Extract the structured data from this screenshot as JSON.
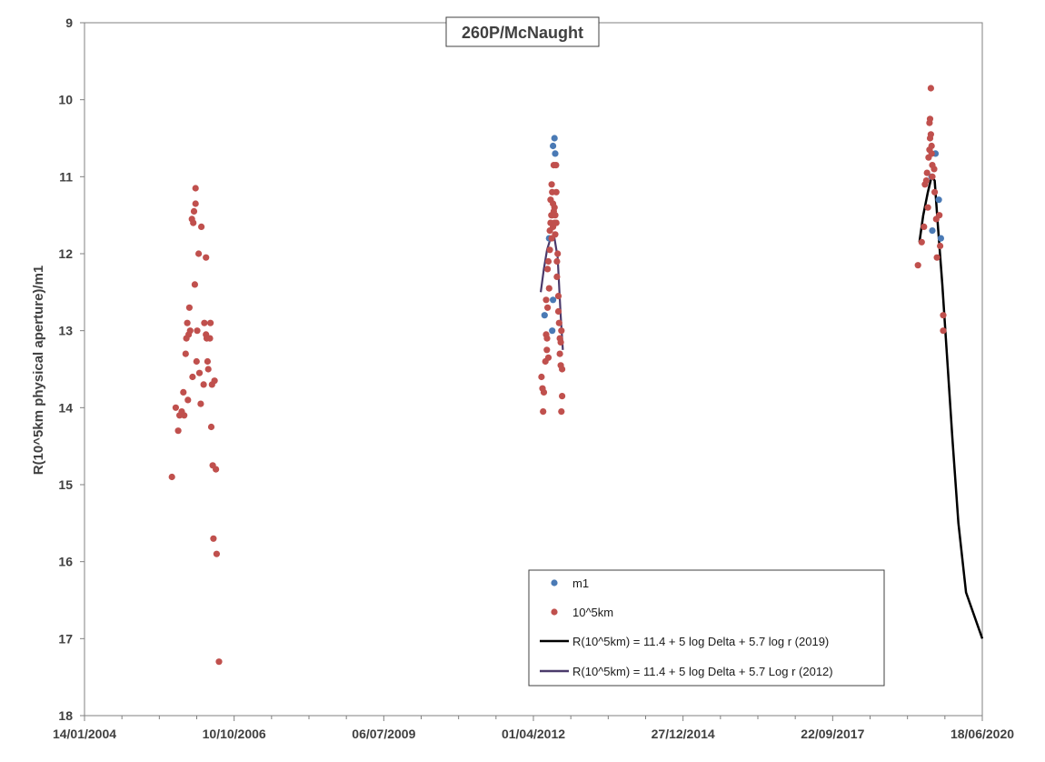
{
  "chart_data": {
    "type": "scatter",
    "title": "260P/McNaught",
    "ylabel": "R(10^5km physical aperture)/m1",
    "xlabel": "",
    "xlim": [
      "2004-01-14",
      "2020-06-18"
    ],
    "ylim": [
      9,
      18
    ],
    "y_inverted": true,
    "x_ticks": [
      "14/01/2004",
      "10/10/2006",
      "06/07/2009",
      "01/04/2012",
      "27/12/2014",
      "22/09/2017",
      "18/06/2020"
    ],
    "y_ticks": [
      "9",
      "10",
      "11",
      "12",
      "13",
      "14",
      "15",
      "16",
      "17",
      "18"
    ],
    "grid": false,
    "legend_position": "bottom-right",
    "colors": {
      "m1": "#4a7ab5",
      "r10": "#c0504d",
      "fit2019": "#000000",
      "fit2012": "#4b3a6b",
      "axis": "#808080"
    },
    "series": [
      {
        "name": "m1",
        "kind": "scatter",
        "points": [
          [
            "2012-08-20",
            10.5
          ],
          [
            "2012-08-10",
            10.6
          ],
          [
            "2012-08-25",
            10.7
          ],
          [
            "2012-07-15",
            11.8
          ],
          [
            "2012-08-10",
            12.6
          ],
          [
            "2012-08-05",
            13.0
          ],
          [
            "2012-06-15",
            12.8
          ],
          [
            "2019-08-10",
            10.7
          ],
          [
            "2019-07-15",
            11.0
          ],
          [
            "2019-09-01",
            11.3
          ],
          [
            "2019-07-20",
            11.7
          ],
          [
            "2019-09-15",
            11.8
          ]
        ]
      },
      {
        "name": "10^5km",
        "kind": "scatter",
        "points": [
          [
            "2005-08-20",
            14.9
          ],
          [
            "2005-09-15",
            14.0
          ],
          [
            "2005-10-01",
            14.3
          ],
          [
            "2005-10-10",
            14.1
          ],
          [
            "2005-10-25",
            14.05
          ],
          [
            "2005-11-05",
            13.8
          ],
          [
            "2005-11-10",
            14.1
          ],
          [
            "2005-11-20",
            13.3
          ],
          [
            "2005-11-25",
            13.1
          ],
          [
            "2005-12-01",
            12.9
          ],
          [
            "2005-12-05",
            13.9
          ],
          [
            "2005-12-10",
            13.05
          ],
          [
            "2005-12-15",
            12.7
          ],
          [
            "2005-12-20",
            13.0
          ],
          [
            "2006-01-01",
            11.55
          ],
          [
            "2006-01-05",
            13.6
          ],
          [
            "2006-01-10",
            11.6
          ],
          [
            "2006-01-15",
            11.45
          ],
          [
            "2006-01-20",
            12.4
          ],
          [
            "2006-01-25",
            11.35
          ],
          [
            "2006-01-25",
            11.15
          ],
          [
            "2006-02-01",
            13.4
          ],
          [
            "2006-02-05",
            13.0
          ],
          [
            "2006-02-15",
            12.0
          ],
          [
            "2006-02-20",
            13.55
          ],
          [
            "2006-03-01",
            13.95
          ],
          [
            "2006-03-05",
            11.65
          ],
          [
            "2006-03-20",
            13.7
          ],
          [
            "2006-03-25",
            12.9
          ],
          [
            "2006-04-05",
            12.05
          ],
          [
            "2006-04-05",
            13.05
          ],
          [
            "2006-04-10",
            13.1
          ],
          [
            "2006-04-15",
            13.4
          ],
          [
            "2006-04-20",
            13.5
          ],
          [
            "2006-05-01",
            13.1
          ],
          [
            "2006-05-05",
            12.9
          ],
          [
            "2006-05-10",
            14.25
          ],
          [
            "2006-05-15",
            13.7
          ],
          [
            "2006-05-20",
            14.75
          ],
          [
            "2006-05-25",
            15.7
          ],
          [
            "2006-06-01",
            13.65
          ],
          [
            "2006-06-10",
            14.8
          ],
          [
            "2006-06-15",
            15.9
          ],
          [
            "2006-07-01",
            17.3
          ],
          [
            "2012-05-25",
            13.6
          ],
          [
            "2012-06-01",
            13.75
          ],
          [
            "2012-06-05",
            14.05
          ],
          [
            "2012-06-10",
            13.8
          ],
          [
            "2012-06-20",
            13.4
          ],
          [
            "2012-06-25",
            12.6
          ],
          [
            "2012-06-25",
            13.05
          ],
          [
            "2012-06-30",
            13.25
          ],
          [
            "2012-07-01",
            13.1
          ],
          [
            "2012-07-05",
            12.7
          ],
          [
            "2012-07-05",
            12.2
          ],
          [
            "2012-07-10",
            13.35
          ],
          [
            "2012-07-10",
            12.1
          ],
          [
            "2012-07-15",
            12.45
          ],
          [
            "2012-07-20",
            11.95
          ],
          [
            "2012-07-20",
            11.7
          ],
          [
            "2012-07-25",
            11.3
          ],
          [
            "2012-07-25",
            11.6
          ],
          [
            "2012-07-30",
            11.5
          ],
          [
            "2012-08-01",
            11.8
          ],
          [
            "2012-08-01",
            11.1
          ],
          [
            "2012-08-05",
            11.5
          ],
          [
            "2012-08-05",
            11.2
          ],
          [
            "2012-08-10",
            11.35
          ],
          [
            "2012-08-10",
            11.65
          ],
          [
            "2012-08-15",
            10.85
          ],
          [
            "2012-08-15",
            11.45
          ],
          [
            "2012-08-20",
            11.6
          ],
          [
            "2012-08-20",
            11.4
          ],
          [
            "2012-08-25",
            11.5
          ],
          [
            "2012-08-25",
            11.75
          ],
          [
            "2012-08-30",
            10.85
          ],
          [
            "2012-09-01",
            11.2
          ],
          [
            "2012-09-01",
            11.6
          ],
          [
            "2012-09-05",
            12.1
          ],
          [
            "2012-09-05",
            12.3
          ],
          [
            "2012-09-10",
            12.0
          ],
          [
            "2012-09-15",
            12.55
          ],
          [
            "2012-09-15",
            12.75
          ],
          [
            "2012-09-20",
            12.9
          ],
          [
            "2012-09-25",
            13.1
          ],
          [
            "2012-09-25",
            13.3
          ],
          [
            "2012-10-01",
            13.15
          ],
          [
            "2012-10-01",
            13.45
          ],
          [
            "2012-10-05",
            14.05
          ],
          [
            "2012-10-05",
            13.0
          ],
          [
            "2012-10-10",
            13.85
          ],
          [
            "2012-10-10",
            13.5
          ],
          [
            "2019-04-15",
            12.15
          ],
          [
            "2019-05-10",
            11.85
          ],
          [
            "2019-05-25",
            11.65
          ],
          [
            "2019-06-01",
            11.1
          ],
          [
            "2019-06-10",
            11.05
          ],
          [
            "2019-06-15",
            10.95
          ],
          [
            "2019-06-20",
            11.4
          ],
          [
            "2019-06-25",
            10.75
          ],
          [
            "2019-07-01",
            10.65
          ],
          [
            "2019-07-01",
            10.3
          ],
          [
            "2019-07-05",
            10.5
          ],
          [
            "2019-07-05",
            10.25
          ],
          [
            "2019-07-10",
            9.85
          ],
          [
            "2019-07-10",
            10.45
          ],
          [
            "2019-07-15",
            10.7
          ],
          [
            "2019-07-15",
            10.6
          ],
          [
            "2019-07-20",
            10.85
          ],
          [
            "2019-07-20",
            11.0
          ],
          [
            "2019-08-01",
            10.9
          ],
          [
            "2019-08-05",
            11.2
          ],
          [
            "2019-08-15",
            11.55
          ],
          [
            "2019-08-20",
            12.05
          ],
          [
            "2019-09-05",
            11.5
          ],
          [
            "2019-09-10",
            11.9
          ],
          [
            "2019-10-01",
            12.8
          ],
          [
            "2019-10-01",
            13.0
          ]
        ]
      },
      {
        "name": "R(10^5km) = 11.4 + 5 log Delta + 5.7 log r (2019)",
        "kind": "line",
        "points": [
          [
            "2019-04-25",
            11.85
          ],
          [
            "2019-05-20",
            11.5
          ],
          [
            "2019-06-20",
            11.2
          ],
          [
            "2019-07-15",
            11.0
          ],
          [
            "2019-08-05",
            11.05
          ],
          [
            "2019-08-25",
            11.6
          ],
          [
            "2019-09-25",
            12.4
          ],
          [
            "2019-10-25",
            13.3
          ],
          [
            "2019-12-01",
            14.4
          ],
          [
            "2020-01-10",
            15.5
          ],
          [
            "2020-03-01",
            16.4
          ],
          [
            "2020-06-18",
            17.0
          ]
        ]
      },
      {
        "name": "R(10^5km) = 11.4 + 5 log Delta + 5.7 Log r (2012)",
        "kind": "line",
        "points": [
          [
            "2012-05-20",
            12.5
          ],
          [
            "2012-06-10",
            12.2
          ],
          [
            "2012-07-01",
            11.95
          ],
          [
            "2012-07-25",
            11.8
          ],
          [
            "2012-08-20",
            11.8
          ],
          [
            "2012-09-10",
            12.05
          ],
          [
            "2012-09-30",
            12.8
          ],
          [
            "2012-10-15",
            13.25
          ]
        ]
      }
    ]
  }
}
